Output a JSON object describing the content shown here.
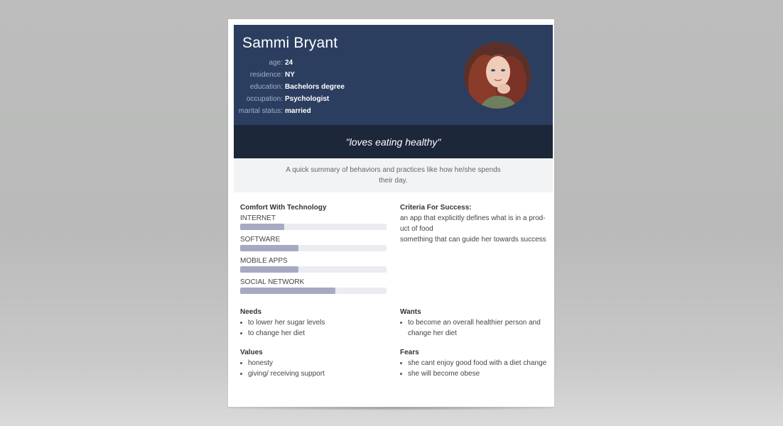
{
  "persona": {
    "name": "Sammi Bryant",
    "info": [
      {
        "key": "age:",
        "value": "24"
      },
      {
        "key": "residence:",
        "value": "NY"
      },
      {
        "key": "education:",
        "value": "Bachelors degree"
      },
      {
        "key": "occupation:",
        "value": "Psychologist"
      },
      {
        "key": "marital status:",
        "value": "married"
      }
    ],
    "quote": "\"loves eating healthy\"",
    "summary": "A quick summary of behaviors and practices like how he/she spends their day."
  },
  "tech": {
    "title": "Comfort With Technology",
    "items": [
      {
        "label": "INTERNET",
        "level": 0.3
      },
      {
        "label": "SOFTWARE",
        "level": 0.4
      },
      {
        "label": "MOBILE APPS",
        "level": 0.4
      },
      {
        "label": "SOCIAL NETWORK",
        "level": 0.65
      }
    ]
  },
  "criteria": {
    "title": "Criteria For Success:",
    "lines": [
      "an app that explicitly defines what is in a prod-uct of food",
      "something that can guide her towards success"
    ]
  },
  "needs": {
    "title": "Needs",
    "items": [
      "to lower her sugar levels",
      "to change her diet"
    ]
  },
  "wants": {
    "title": "Wants",
    "items": [
      "to become an overall healthier person and change her diet"
    ]
  },
  "values": {
    "title": "Values",
    "items": [
      "honesty",
      "giving/ receiving support"
    ]
  },
  "fears": {
    "title": "Fears",
    "items": [
      "she cant enjoy good food with a diet change",
      "she will become obese"
    ]
  },
  "colors": {
    "header": "#2c3e60",
    "quote_bar": "#1c273a",
    "bar_fill": "#a7a9c4",
    "bar_track": "#ebecf0"
  }
}
